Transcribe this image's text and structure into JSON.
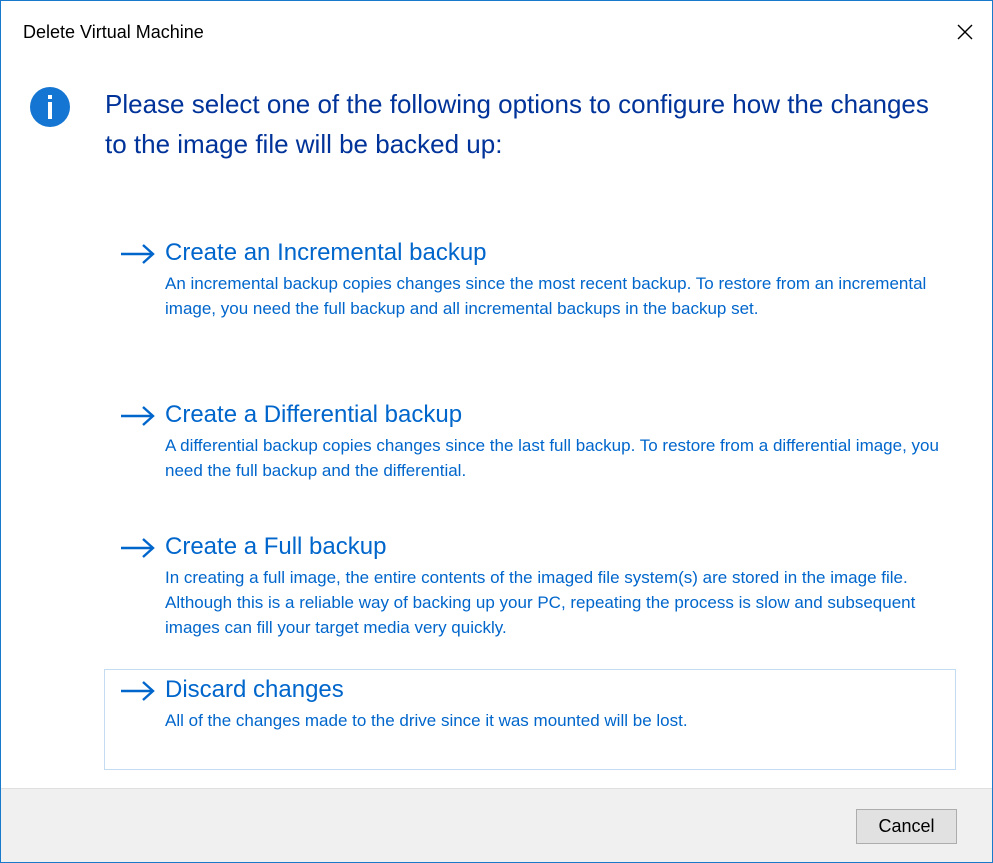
{
  "window": {
    "title": "Delete Virtual Machine",
    "close_icon": "close-icon"
  },
  "main_instruction": {
    "icon": "info-icon",
    "text": "Please select one of the following options to configure how the changes to the image file will be backed up:"
  },
  "options": [
    {
      "title": "Create an Incremental backup",
      "description": "An incremental backup copies changes since the most recent backup. To restore from an incremental image, you need the full backup and all incremental backups in the backup set."
    },
    {
      "title": "Create a Differential backup",
      "description": "A differential backup copies changes since the last full backup. To restore from a differential image, you need the full backup and the differential."
    },
    {
      "title": "Create a Full backup",
      "description": "In creating a full image, the entire contents of the imaged file system(s) are stored in the image file. Although this is a reliable way of backing up your PC, repeating the process is slow and subsequent images can fill your target media very quickly."
    },
    {
      "title": "Discard changes",
      "description": "All of the changes made to the drive since it was mounted will be lost.",
      "hovered": true
    }
  ],
  "footer": {
    "cancel_label": "Cancel"
  },
  "colors": {
    "accent_blue": "#0066cc",
    "instruction_blue": "#003399",
    "info_icon_fill": "#1475d2",
    "hover_border": "#c4dcf2",
    "footer_bg": "#f0f0f0"
  }
}
